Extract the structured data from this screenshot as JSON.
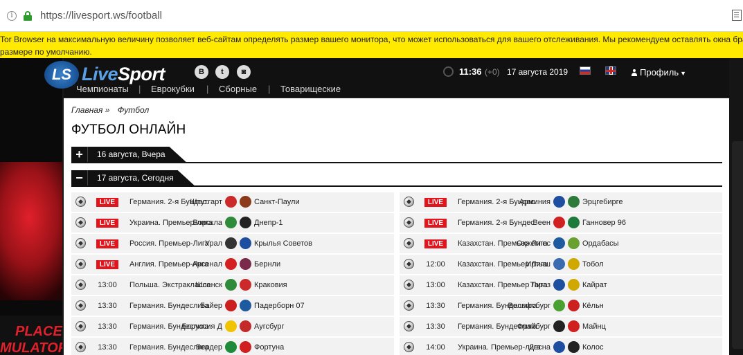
{
  "browser": {
    "url_scheme": "https://",
    "url_host": "livesport.ws",
    "url_path": "/football"
  },
  "warning": {
    "line1": "Tor Browser на максимальную величину позволяет веб-сайтам определять размер вашего монитора, что может использоваться для вашего отслеживания. Мы рекомендуем оставлять окна брау",
    "line2": "размере по умолчанию."
  },
  "ad": {
    "line1": "PLACE",
    "line2": "MULATOR"
  },
  "header": {
    "logo_mark": "LS",
    "logo_live": "Live",
    "logo_sport": "Sport",
    "social": [
      "B",
      "t",
      "◙"
    ],
    "time": "11:36",
    "tz": "(+0)",
    "date": "17 августа 2019",
    "profile": "Профиль"
  },
  "nav": [
    "Чемпионаты",
    "Еврокубки",
    "Сборные",
    "Товарищеские"
  ],
  "crumbs": [
    "Главная »",
    "Футбол"
  ],
  "page_title": "ФУТБОЛ ОНЛАЙН",
  "days": [
    {
      "toggle": "+",
      "label": "16 августа, Вчера"
    },
    {
      "toggle": "−",
      "label": "17 августа, Сегодня"
    }
  ],
  "live_label": "LIVE",
  "colors": {
    "live": "#e3141c",
    "header": "#111111",
    "row": "#f2f2f2",
    "warning": "#ffea00"
  },
  "matches_left": [
    {
      "time": "LIVE",
      "league": "Германия. 2-я Бундес.",
      "home": "Штутгарт",
      "away": "Санкт-Паули",
      "c1": "#cc2a2a",
      "c2": "#8b3a1a"
    },
    {
      "time": "LIVE",
      "league": "Украина. Премьер-лига",
      "home": "Ворскла",
      "away": "Днепр-1",
      "c1": "#2e8b3a",
      "c2": "#222222"
    },
    {
      "time": "LIVE",
      "league": "Россия. Премьер-Лига",
      "home": "Урал",
      "away": "Крылья Советов",
      "c1": "#333333",
      "c2": "#1e4ea0"
    },
    {
      "time": "LIVE",
      "league": "Англия. Премьер-Лига",
      "home": "Арсенал",
      "away": "Бернли",
      "c1": "#d42020",
      "c2": "#7a2a4a"
    },
    {
      "time": "13:00",
      "league": "Польша. Экстракласса",
      "home": "Шленск",
      "away": "Краковия",
      "c1": "#2e8b3a",
      "c2": "#cc2a2a"
    },
    {
      "time": "13:30",
      "league": "Германия. Бундеслига",
      "home": "Байер",
      "away": "Падерборн 07",
      "c1": "#cc2020",
      "c2": "#1e5aa0"
    },
    {
      "time": "13:30",
      "league": "Германия. Бундеслига",
      "home": "Боруссия Д",
      "away": "Аугсбург",
      "c1": "#f0c400",
      "c2": "#c42a2a"
    },
    {
      "time": "13:30",
      "league": "Германия. Бундеслига",
      "home": "Вердер",
      "away": "Фортуна",
      "c1": "#1e8a3a",
      "c2": "#d02020"
    }
  ],
  "matches_right": [
    {
      "time": "LIVE",
      "league": "Германия. 2-я Бундес.",
      "home": "Арминия",
      "away": "Эрцгебирге",
      "c1": "#1e4ea0",
      "c2": "#2e7a3a"
    },
    {
      "time": "LIVE",
      "league": "Германия. 2-я Бундес.",
      "home": "Веен",
      "away": "Ганновер 96",
      "c1": "#d02020",
      "c2": "#1e7a3a"
    },
    {
      "time": "LIVE",
      "league": "Казахстан. Премьер Лига",
      "home": "Окжетпес",
      "away": "Ордабасы",
      "c1": "#1e5aa0",
      "c2": "#6aa030"
    },
    {
      "time": "12:00",
      "league": "Казахстан. Премьер Лига",
      "home": "Иртыш",
      "away": "Тобол",
      "c1": "#3a6ab0",
      "c2": "#d0a800"
    },
    {
      "time": "13:00",
      "league": "Казахстан. Премьер Лига",
      "home": "Тараз",
      "away": "Кайрат",
      "c1": "#1e4ea0",
      "c2": "#d0a800"
    },
    {
      "time": "13:30",
      "league": "Германия. Бундеслига",
      "home": "Вольфсбург",
      "away": "Кёльн",
      "c1": "#4aa030",
      "c2": "#cc2020"
    },
    {
      "time": "13:30",
      "league": "Германия. Бундеслига",
      "home": "Фрайбург",
      "away": "Майнц",
      "c1": "#222222",
      "c2": "#d02020"
    },
    {
      "time": "14:00",
      "league": "Украина. Премьер-лига",
      "home": "Десна",
      "away": "Колос",
      "c1": "#1e4ea0",
      "c2": "#222222"
    }
  ]
}
